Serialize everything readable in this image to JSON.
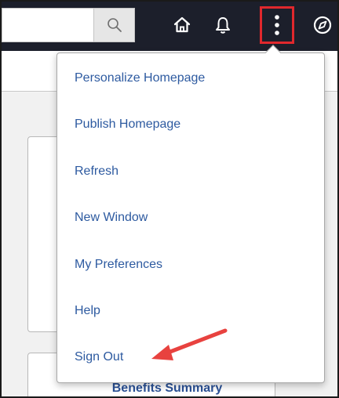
{
  "header": {
    "icons": [
      "search-icon",
      "home-icon",
      "bell-icon",
      "actions-menu-icon",
      "navigator-icon"
    ],
    "actions_highlight_color": "#e0282d"
  },
  "menu": {
    "items": [
      {
        "label": "Personalize Homepage"
      },
      {
        "label": "Publish Homepage"
      },
      {
        "label": "Refresh"
      },
      {
        "label": "New Window"
      },
      {
        "label": "My Preferences"
      },
      {
        "label": "Help"
      },
      {
        "label": "Sign Out"
      }
    ],
    "link_color": "#2d5aa0"
  },
  "tiles": {
    "benefits_title": "Benefits Summary"
  },
  "annotation": {
    "arrow_color": "#e8423f",
    "points_to": "Sign Out"
  }
}
